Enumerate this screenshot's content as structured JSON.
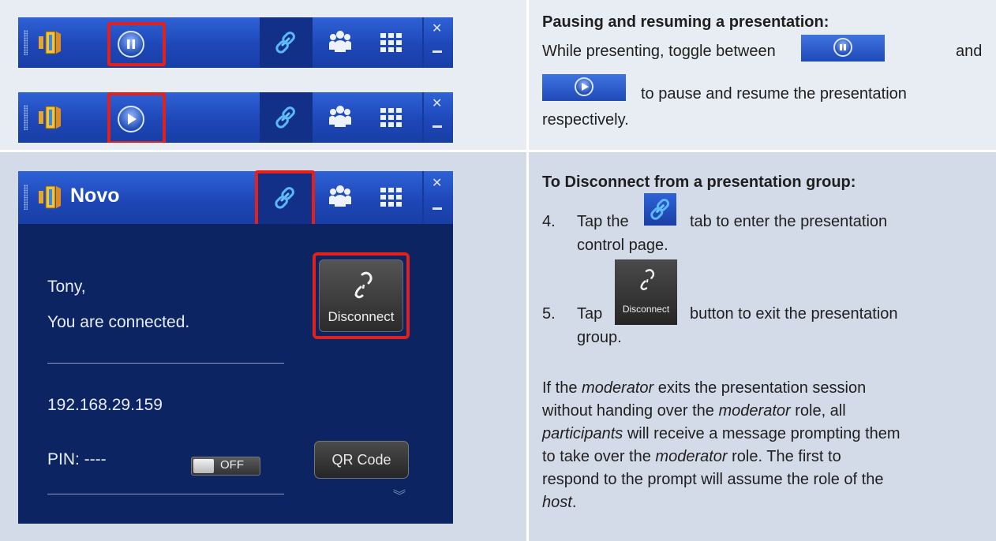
{
  "pause_section": {
    "heading": "Pausing and resuming a presentation:",
    "line1_prefix": "While presenting, toggle between",
    "line1_suffix": "and",
    "line2_suffix": "to pause and resume the presentation",
    "line3": "respectively."
  },
  "disconnect_section": {
    "heading": "To Disconnect from a presentation group:",
    "step4_num": "4.",
    "step4_prefix": "Tap the",
    "step4_suffix": "tab to enter the presentation",
    "step4_cont": "control page.",
    "step5_num": "5.",
    "step5_prefix": "Tap",
    "step5_suffix": "button to exit the presentation",
    "step5_cont": "group.",
    "para": [
      [
        "If the ",
        "moderator",
        " exits the presentation session"
      ],
      [
        "without handing over the ",
        "moderator",
        " role, all"
      ],
      [
        "",
        "participants",
        " will receive a message prompting them"
      ],
      [
        "to take over the ",
        "moderator",
        " role. The first to"
      ],
      [
        "respond to the prompt will assume the role of the",
        "",
        ""
      ],
      [
        "",
        "host",
        "."
      ]
    ]
  },
  "app_panel": {
    "title": "Novo",
    "greeting": "Tony,",
    "status": "You are connected.",
    "ip": "192.168.29.159",
    "pin": "PIN: ----",
    "toggle_label": "OFF",
    "disconnect_label": "Disconnect",
    "qr_label": "QR Code"
  },
  "colors": {
    "highlight": "#e2211c",
    "toolbar_blue": "#1e47b8",
    "panel_navy": "#0c2462"
  }
}
